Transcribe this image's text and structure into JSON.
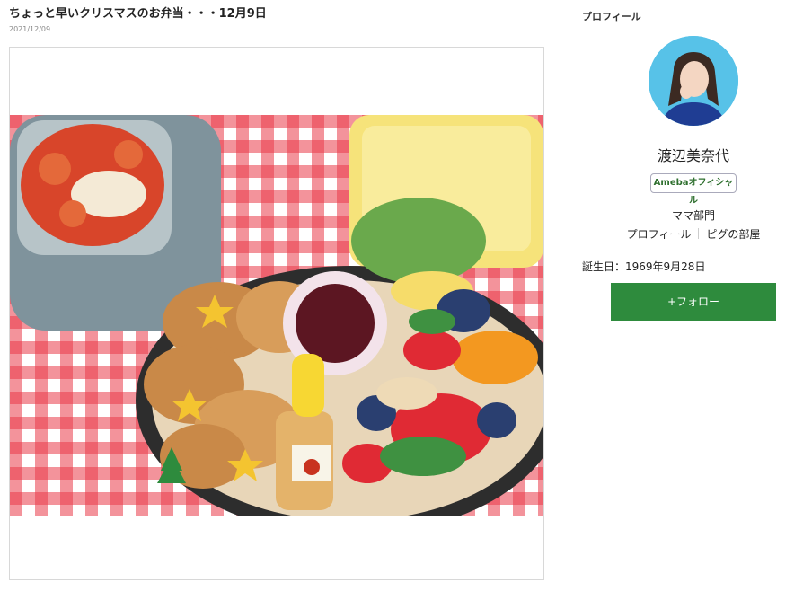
{
  "post": {
    "title": "ちょっと早いクリスマスのお弁当・・・12月9日",
    "date": "2021/12/09"
  },
  "sidebar": {
    "heading": "プロフィール",
    "name": "渡辺美奈代",
    "badge": "Amebaオフィシャル",
    "category": "ママ部門",
    "links": [
      "プロフィール",
      "ピグの部屋"
    ],
    "birthday": "誕生日：1969年9月28日",
    "follow_label": "+フォロー"
  },
  "colors": {
    "accent_green": "#2e8b3d",
    "avatar_bg": "#57c2e8"
  }
}
